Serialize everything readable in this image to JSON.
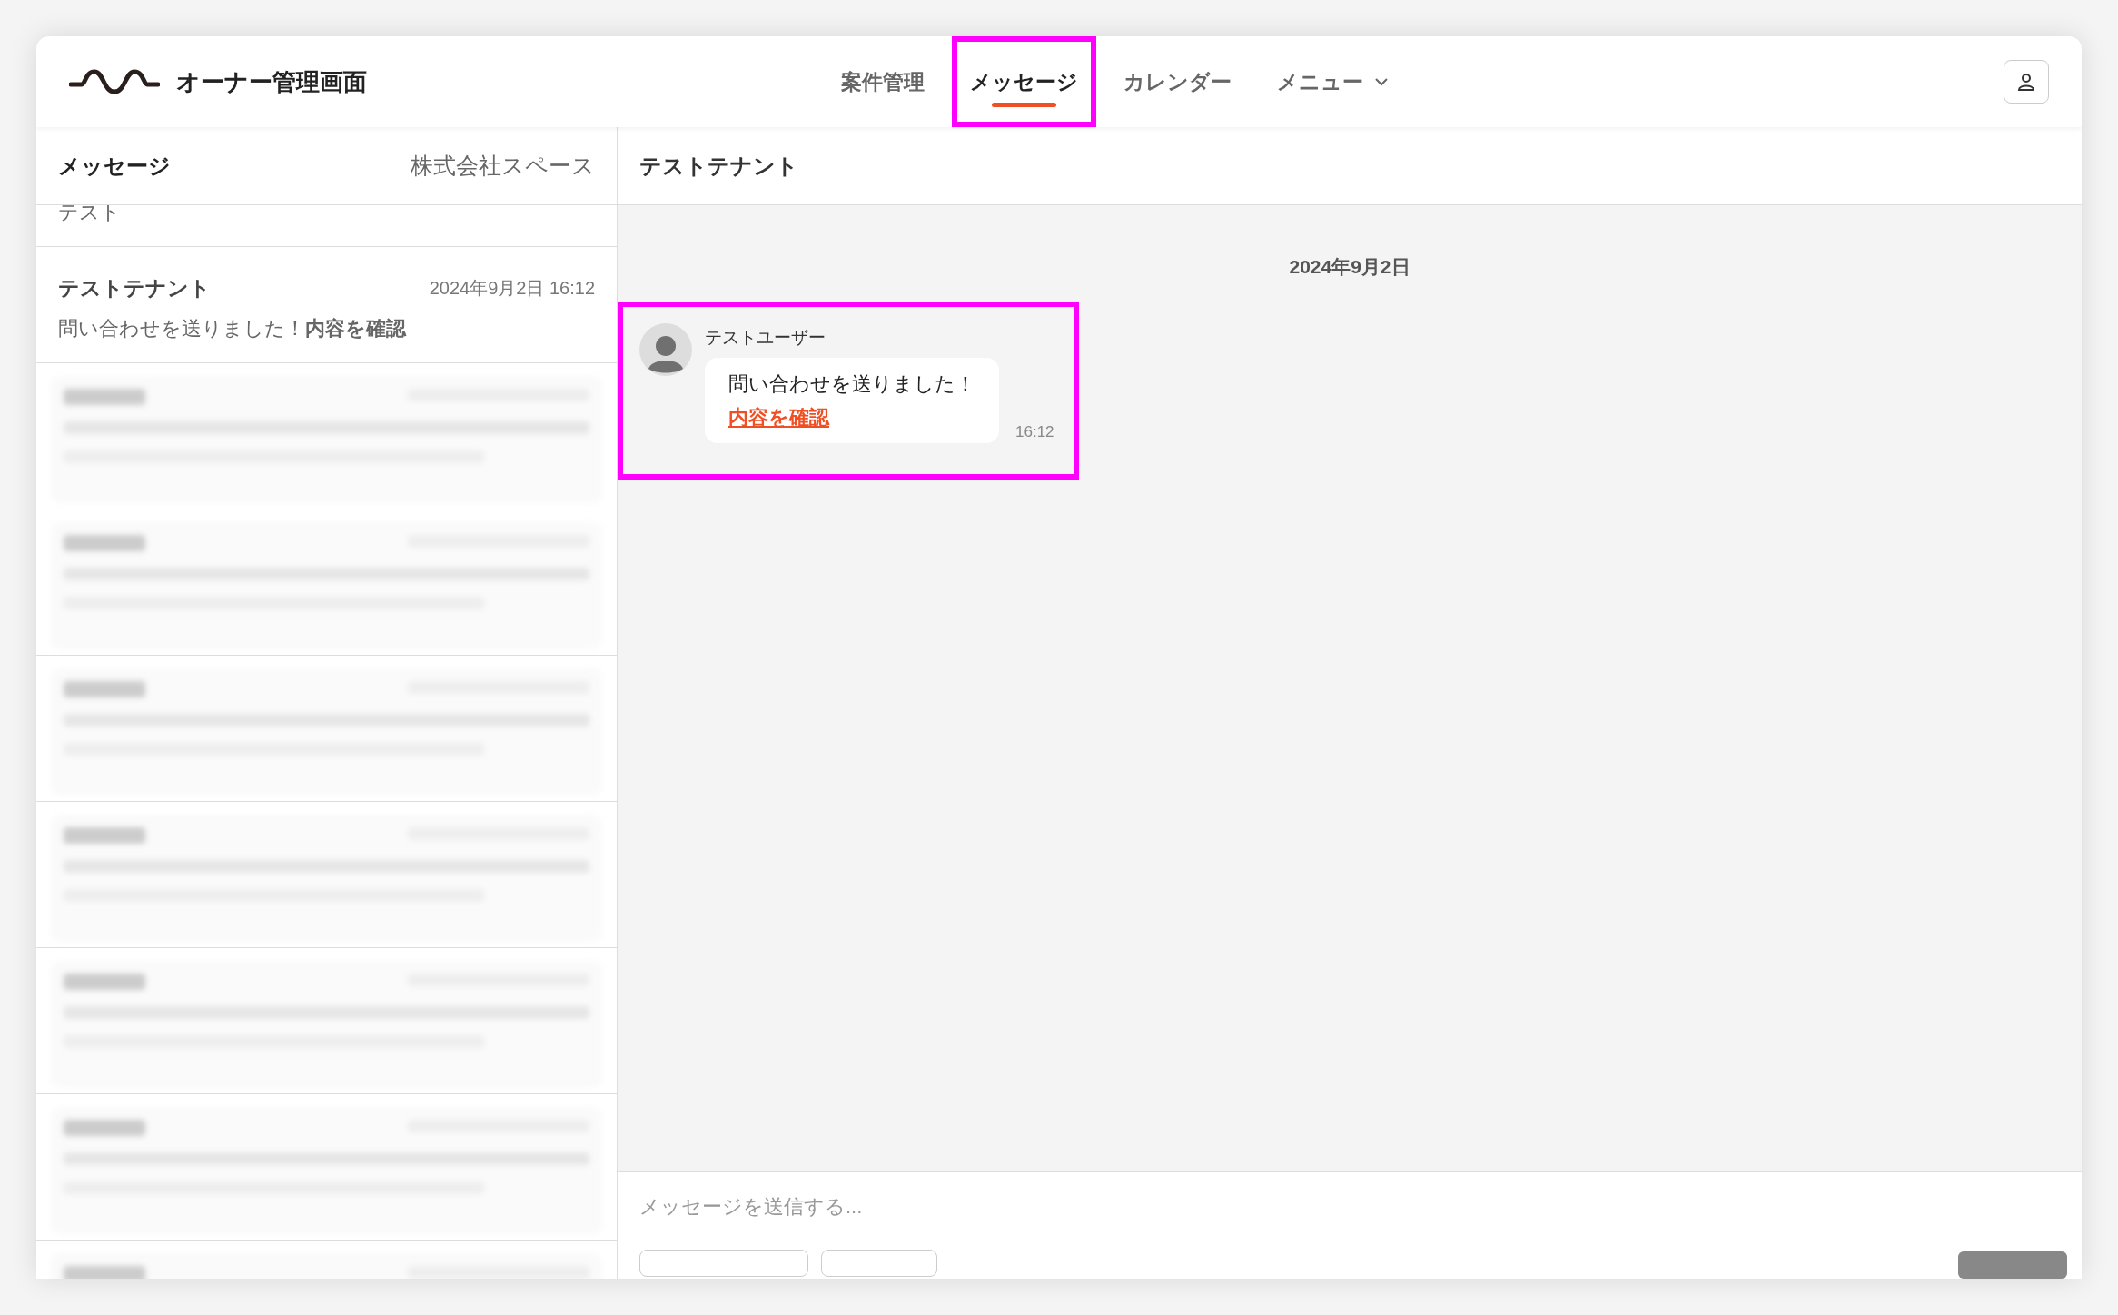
{
  "header": {
    "title": "オーナー管理画面",
    "nav": [
      {
        "label": "案件管理",
        "selected": false,
        "highlighted": false,
        "kind": "link"
      },
      {
        "label": "メッセージ",
        "selected": true,
        "highlighted": true,
        "kind": "link"
      },
      {
        "label": "カレンダー",
        "selected": false,
        "highlighted": false,
        "kind": "link"
      },
      {
        "label": "メニュー",
        "selected": false,
        "highlighted": false,
        "kind": "dropdown"
      }
    ]
  },
  "sidebar": {
    "title": "メッセージ",
    "company": "株式会社スペース",
    "partial_item": "テスト",
    "items": [
      {
        "kind": "thread",
        "name": "テストテナント",
        "time": "2024年9月2日 16:12",
        "preview": "問い合わせを送りました！**内容を確認**"
      },
      {
        "kind": "blurred"
      },
      {
        "kind": "blurred"
      },
      {
        "kind": "blurred"
      },
      {
        "kind": "blurred"
      },
      {
        "kind": "blurred"
      },
      {
        "kind": "blurred"
      },
      {
        "kind": "blurred"
      }
    ]
  },
  "chat": {
    "title": "テストテナント",
    "date": "2024年9月2日",
    "messages": [
      {
        "sender": "テストユーザー",
        "text": "問い合わせを送りました！",
        "link": "内容を確認",
        "time": "16:12",
        "highlighted": true
      }
    ],
    "input": {
      "placeholder": "メッセージを送信する..."
    }
  }
}
